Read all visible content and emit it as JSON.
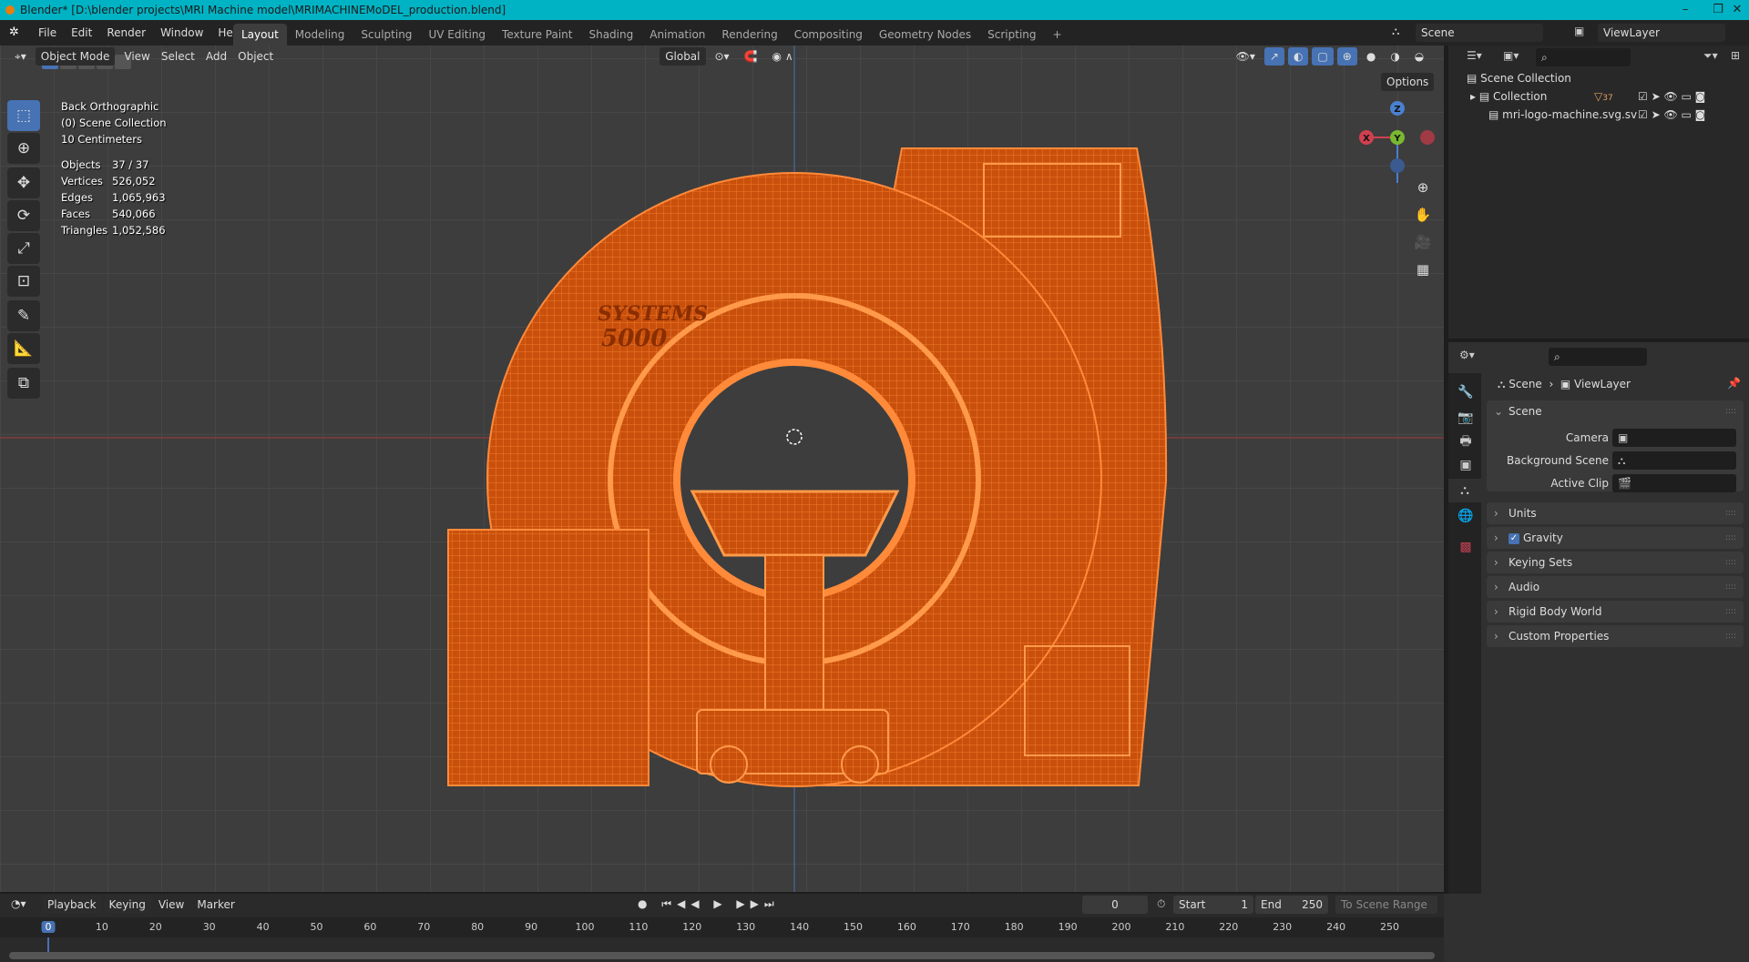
{
  "title": "Blender* [D:\\blender projects\\MRI Machine model\\MRIMACHINEMoDEL_production.blend]",
  "menu": [
    "File",
    "Edit",
    "Render",
    "Window",
    "Help"
  ],
  "workspaces": [
    "Layout",
    "Modeling",
    "Sculpting",
    "UV Editing",
    "Texture Paint",
    "Shading",
    "Animation",
    "Rendering",
    "Compositing",
    "Geometry Nodes",
    "Scripting",
    "+"
  ],
  "scene": "Scene",
  "view_layer": "ViewLayer",
  "viewport": {
    "mode": "Object Mode",
    "menus": [
      "View",
      "Select",
      "Add",
      "Object"
    ],
    "orientation": "Global",
    "options": "Options",
    "overlay": {
      "view": "Back Orthographic",
      "collection": "(0) Scene Collection",
      "scale": "10 Centimeters",
      "stats": [
        {
          "k": "Objects",
          "v": "37 / 37"
        },
        {
          "k": "Vertices",
          "v": "526,052"
        },
        {
          "k": "Edges",
          "v": "1,065,963"
        },
        {
          "k": "Faces",
          "v": "540,066"
        },
        {
          "k": "Triangles",
          "v": "1,052,586"
        }
      ]
    },
    "gizmo": {
      "x": "X",
      "y": "Y",
      "z": "Z"
    },
    "model_text": {
      "brand": "SYSTEMS",
      "number": "5000"
    }
  },
  "outliner": {
    "root": "Scene Collection",
    "items": [
      {
        "name": "Collection",
        "badge": "37"
      },
      {
        "name": "mri-logo-machine.svg.sv"
      }
    ]
  },
  "properties": {
    "breadcrumb": [
      "Scene",
      "ViewLayer"
    ],
    "section": "Scene",
    "fields": [
      {
        "label": "Camera"
      },
      {
        "label": "Background Scene"
      },
      {
        "label": "Active Clip"
      }
    ],
    "panels": [
      "Units",
      "Gravity",
      "Keying Sets",
      "Audio",
      "Rigid Body World",
      "Custom Properties"
    ]
  },
  "timeline": {
    "menus": [
      "Playback",
      "Keying",
      "View",
      "Marker"
    ],
    "current": "0",
    "start_label": "Start",
    "start": "1",
    "end_label": "End",
    "end": "250",
    "range": "To Scene Range",
    "frames": [
      "0",
      "10",
      "20",
      "30",
      "40",
      "50",
      "60",
      "70",
      "80",
      "90",
      "100",
      "110",
      "120",
      "130",
      "140",
      "150",
      "160",
      "170",
      "180",
      "190",
      "200",
      "210",
      "220",
      "230",
      "240",
      "250"
    ]
  },
  "colors": {
    "accent": "#4772b3",
    "selection": "#e8600c",
    "titlebar": "#00b3c4"
  }
}
